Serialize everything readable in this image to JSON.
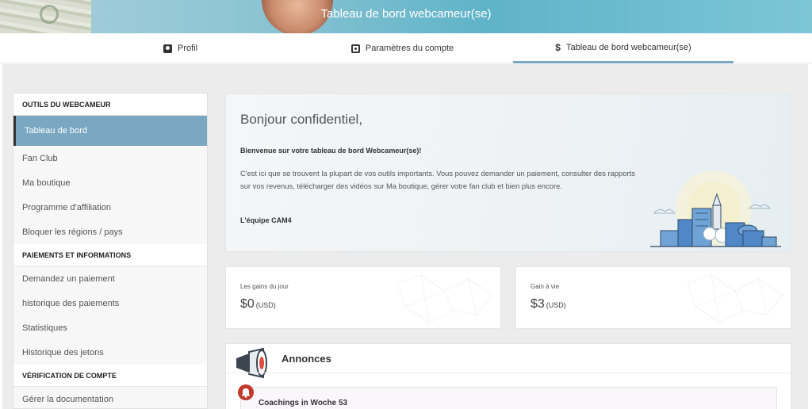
{
  "banner": {
    "title": "Tableau de bord webcameur(se)"
  },
  "tabs": [
    {
      "label": "Profil",
      "icon": "profile-icon"
    },
    {
      "label": "Paramètres du compte",
      "icon": "settings-icon"
    },
    {
      "label": "Tableau de bord webcameur(se)",
      "icon": "dollar-icon",
      "active": true
    }
  ],
  "sidebar": {
    "sections": [
      {
        "heading": "OUTILS DU WEBCAMEUR",
        "items": [
          "Tableau de bord",
          "Fan Club",
          "Ma boutique",
          "Programme d'affiliation",
          "Bloquer les régions / pays"
        ]
      },
      {
        "heading": "PAIEMENTS ET INFORMATIONS",
        "items": [
          "Demandez un paiement",
          "historique des paiements",
          "Statistiques",
          "Historique des jetons"
        ]
      },
      {
        "heading": "VÉRIFICATION DE COMPTE",
        "items": [
          "Gérer la documentation"
        ]
      }
    ],
    "active_item": "Tableau de bord"
  },
  "welcome": {
    "greeting": "Bonjour confidentiel,",
    "subtitle": "Bienvenue sur votre tableau de bord Webcameur(se)!",
    "body": "C'est ici que se trouvent la plupart de vos outils importants. Vous pouvez demander un paiement, consulter des rapports sur vos revenus, télécharger des vidéos sur Ma boutique, gérer votre fan club et bien plus encore.",
    "signature": "L'équipe CAM4"
  },
  "stats": {
    "daily": {
      "label": "Les gains du jour",
      "value": "$0",
      "currency": "(USD)"
    },
    "lifetime": {
      "label": "Gain à vie",
      "value": "$3",
      "currency": "(USD)"
    }
  },
  "announcements": {
    "title": "Annonces",
    "items": [
      {
        "title": "Coachings in Woche 53"
      }
    ]
  },
  "colors": {
    "accent": "#7aa7c2",
    "banner": "#5fb3c8",
    "alert": "#c0392b"
  }
}
